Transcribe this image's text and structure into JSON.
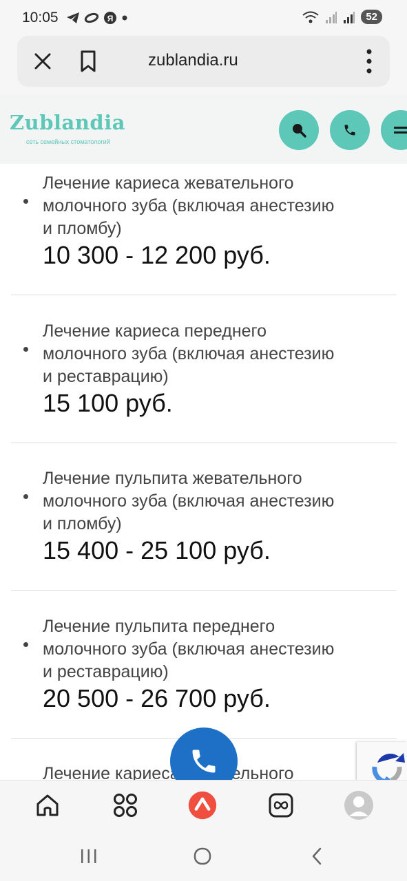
{
  "status_bar": {
    "time": "10:05",
    "left_icons": [
      "telegram-icon",
      "link-icon",
      "yandex-icon",
      "dot-icon"
    ],
    "right_icons": [
      "wifi-icon",
      "signal-icon",
      "signal-icon"
    ],
    "battery": "52"
  },
  "browser": {
    "url": "zublandia.ru",
    "close_icon": "close-icon",
    "bookmark_icon": "bookmark-icon",
    "more_icon": "more-vertical-icon"
  },
  "site_header": {
    "logo": "Zublandia",
    "tagline": "сеть семейных стоматологий",
    "buttons": [
      "search-icon",
      "phone-icon",
      "menu-icon"
    ],
    "accent_color": "#5dc7b8"
  },
  "services": [
    {
      "name_lines": [
        "Лечение кариеса жевательного",
        "молочного зуба (включая анестезию",
        "и пломбу)"
      ],
      "price": "10 300 - 12 200 руб."
    },
    {
      "name_lines": [
        "Лечение кариеса переднего",
        "молочного зуба (включая анестезию",
        "и реставрацию)"
      ],
      "price": "15 100 руб."
    },
    {
      "name_lines": [
        "Лечение пульпита жевательного",
        "молочного зуба (включая анестезию",
        "и пломбу)"
      ],
      "price": "15 400 - 25 100 руб."
    },
    {
      "name_lines": [
        "Лечение пульпита переднего",
        "молочного зуба (включая анестезию",
        "и реставрацию)"
      ],
      "price": "20 500 - 26 700 руб."
    },
    {
      "name_lines": [
        "Лечение кариеса жевательного"
      ]
    }
  ],
  "floating": {
    "call_icon": "phone-icon",
    "call_color": "#1e6fc6",
    "recaptcha_icon": "recaptcha-icon"
  },
  "bottom_nav": [
    "home-icon",
    "apps-icon",
    "alice-icon",
    "tabs-icon",
    "profile-icon"
  ],
  "system_nav": [
    "recents-icon",
    "home-circle-icon",
    "back-icon"
  ]
}
